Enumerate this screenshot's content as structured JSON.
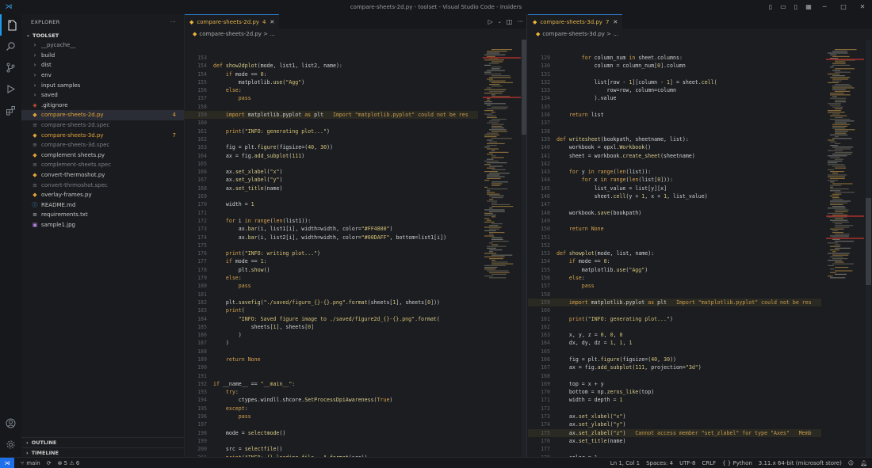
{
  "window": {
    "title": "compare-sheets-2d.py - toolset - Visual Studio Code - Insiders"
  },
  "sidebar": {
    "header": "EXPLORER",
    "root": "TOOLSET",
    "items": [
      {
        "label": "__pycache__",
        "kind": "folder",
        "color": "#9aa0a6"
      },
      {
        "label": "build",
        "kind": "folder",
        "color": "#c5c5c5"
      },
      {
        "label": "dist",
        "kind": "folder",
        "color": "#c5c5c5"
      },
      {
        "label": "env",
        "kind": "folder",
        "color": "#c5c5c5"
      },
      {
        "label": "input samples",
        "kind": "folder",
        "color": "#c5c5c5"
      },
      {
        "label": "saved",
        "kind": "folder",
        "color": "#c5c5c5"
      },
      {
        "label": ".gitignore",
        "kind": "git",
        "color": "#c5c5c5"
      },
      {
        "label": "compare-sheets-2d.py",
        "kind": "py",
        "color": "#e2a23a",
        "badge": "4",
        "selected": true
      },
      {
        "label": "compare-sheets-2d.spec",
        "kind": "spec",
        "color": "#7a7f86"
      },
      {
        "label": "compare-sheets-3d.py",
        "kind": "py",
        "color": "#e2a23a",
        "badge": "7"
      },
      {
        "label": "compare-sheets-3d.spec",
        "kind": "spec",
        "color": "#7a7f86"
      },
      {
        "label": "complement sheets.py",
        "kind": "py",
        "color": "#c5c5c5"
      },
      {
        "label": "complement-sheets.spec",
        "kind": "spec",
        "color": "#7a7f86"
      },
      {
        "label": "convert-thermoshot.py",
        "kind": "py",
        "color": "#c5c5c5"
      },
      {
        "label": "convert-thrmoshot.spec",
        "kind": "spec",
        "color": "#7a7f86"
      },
      {
        "label": "overlay-frames.py",
        "kind": "py",
        "color": "#c5c5c5"
      },
      {
        "label": "README.md",
        "kind": "md",
        "color": "#c5c5c5"
      },
      {
        "label": "requirements.txt",
        "kind": "txt",
        "color": "#c5c5c5"
      },
      {
        "label": "sample1.jpg",
        "kind": "img",
        "color": "#c5c5c5"
      }
    ],
    "outline": "OUTLINE",
    "timeline": "TIMELINE"
  },
  "editor_left": {
    "tab": {
      "label": "compare-sheets-2d.py",
      "badge": "4"
    },
    "breadcrumb": "compare-sheets-2d.py > ...",
    "lines": [
      {
        "n": "153",
        "t": ""
      },
      {
        "n": "154",
        "t": "def show2dplot(mode, list1, list2, name):"
      },
      {
        "n": "154",
        "t": "    if mode == 0:"
      },
      {
        "n": "155",
        "t": "        matplotlib.use(\"Agg\")"
      },
      {
        "n": "156",
        "t": "    else:"
      },
      {
        "n": "157",
        "t": "        pass"
      },
      {
        "n": "158",
        "t": ""
      },
      {
        "n": "159",
        "t": "    import matplotlib.pyplot as plt   Import \"matplotlib.pyplot\" could not be res",
        "hl": true
      },
      {
        "n": "160",
        "t": ""
      },
      {
        "n": "161",
        "t": "    print(\"INFO: generating plot...\")"
      },
      {
        "n": "162",
        "t": ""
      },
      {
        "n": "163",
        "t": "    fig = plt.figure(figsize=(40, 30))"
      },
      {
        "n": "164",
        "t": "    ax = fig.add_subplot(111)"
      },
      {
        "n": "165",
        "t": ""
      },
      {
        "n": "166",
        "t": "    ax.set_xlabel(\"x\")"
      },
      {
        "n": "167",
        "t": "    ax.set_ylabel(\"y\")"
      },
      {
        "n": "168",
        "t": "    ax.set_title(name)"
      },
      {
        "n": "169",
        "t": ""
      },
      {
        "n": "170",
        "t": "    width = 1"
      },
      {
        "n": "171",
        "t": ""
      },
      {
        "n": "172",
        "t": "    for i in range(len(list1)):"
      },
      {
        "n": "173",
        "t": "        ax.bar(i, list1[i], width=width, color=\"#FF4800\")"
      },
      {
        "n": "174",
        "t": "        ax.bar(i, list2[i], width=width, color=\"#00DAFF\", bottom=list1[i])"
      },
      {
        "n": "175",
        "t": ""
      },
      {
        "n": "176",
        "t": "    print(\"INFO: writing plot...\")"
      },
      {
        "n": "177",
        "t": "    if mode == 1:"
      },
      {
        "n": "178",
        "t": "        plt.show()"
      },
      {
        "n": "179",
        "t": "    else:"
      },
      {
        "n": "180",
        "t": "        pass"
      },
      {
        "n": "181",
        "t": ""
      },
      {
        "n": "182",
        "t": "    plt.savefig(\"./saved/figure_{}-{}.png\".format(sheets[1], sheets[0]))"
      },
      {
        "n": "183",
        "t": "    print("
      },
      {
        "n": "184",
        "t": "        \"INFO: Saved figure image to ./saved/figure2d_{}-{}.png\".format("
      },
      {
        "n": "185",
        "t": "            sheets[1], sheets[0]"
      },
      {
        "n": "186",
        "t": "        )"
      },
      {
        "n": "187",
        "t": "    )"
      },
      {
        "n": "188",
        "t": ""
      },
      {
        "n": "189",
        "t": "    return None"
      },
      {
        "n": "190",
        "t": ""
      },
      {
        "n": "191",
        "t": ""
      },
      {
        "n": "192",
        "t": "if __name__ == \"__main__\":"
      },
      {
        "n": "193",
        "t": "    try:"
      },
      {
        "n": "194",
        "t": "        ctypes.windll.shcore.SetProcessDpiAwareness(True)"
      },
      {
        "n": "195",
        "t": "    except:"
      },
      {
        "n": "196",
        "t": "        pass"
      },
      {
        "n": "197",
        "t": ""
      },
      {
        "n": "198",
        "t": "    mode = selectmode()"
      },
      {
        "n": "199",
        "t": ""
      },
      {
        "n": "200",
        "t": "    src = selectfile()"
      },
      {
        "n": "201",
        "t": "    print(\"INFO: {} loading file...\".format(src))"
      }
    ]
  },
  "editor_right": {
    "tab": {
      "label": "compare-sheets-3d.py",
      "badge": "7"
    },
    "breadcrumb": "compare-sheets-3d.py > ...",
    "lines": [
      {
        "n": "129",
        "t": "        for column_num in sheet.columns:"
      },
      {
        "n": "130",
        "t": "            column = column_num[0].column"
      },
      {
        "n": "131",
        "t": ""
      },
      {
        "n": "132",
        "t": "            list[row - 1][column - 1] = sheet.cell("
      },
      {
        "n": "133",
        "t": "                row=row, column=column"
      },
      {
        "n": "134",
        "t": "            ).value"
      },
      {
        "n": "135",
        "t": ""
      },
      {
        "n": "136",
        "t": "    return list"
      },
      {
        "n": "137",
        "t": ""
      },
      {
        "n": "138",
        "t": ""
      },
      {
        "n": "139",
        "t": "def writesheet(bookpath, sheetname, list):"
      },
      {
        "n": "140",
        "t": "    workbook = opxl.Workbook()"
      },
      {
        "n": "141",
        "t": "    sheet = workbook.create_sheet(sheetname)"
      },
      {
        "n": "142",
        "t": ""
      },
      {
        "n": "143",
        "t": "    for y in range(len(list)):"
      },
      {
        "n": "144",
        "t": "        for x in range(len(list[0])):"
      },
      {
        "n": "145",
        "t": "            list_value = list[y][x]"
      },
      {
        "n": "146",
        "t": "            sheet.cell(y + 1, x + 1, list_value)"
      },
      {
        "n": "147",
        "t": ""
      },
      {
        "n": "148",
        "t": "    workbook.save(bookpath)"
      },
      {
        "n": "149",
        "t": ""
      },
      {
        "n": "150",
        "t": "    return None"
      },
      {
        "n": "151",
        "t": ""
      },
      {
        "n": "152",
        "t": ""
      },
      {
        "n": "153",
        "t": "def showplot(mode, list, name):"
      },
      {
        "n": "154",
        "t": "    if mode == 0:"
      },
      {
        "n": "155",
        "t": "        matplotlib.use(\"Agg\")"
      },
      {
        "n": "156",
        "t": "    else:"
      },
      {
        "n": "157",
        "t": "        pass"
      },
      {
        "n": "158",
        "t": ""
      },
      {
        "n": "159",
        "t": "    import matplotlib.pyplot as plt   Import \"matplotlib.pyplot\" could not be res",
        "hl": true
      },
      {
        "n": "160",
        "t": ""
      },
      {
        "n": "161",
        "t": "    print(\"INFO: generating plot...\")"
      },
      {
        "n": "162",
        "t": ""
      },
      {
        "n": "163",
        "t": "    x, y, z = 0, 0, 0"
      },
      {
        "n": "164",
        "t": "    dx, dy, dz = 1, 1, 1"
      },
      {
        "n": "165",
        "t": ""
      },
      {
        "n": "166",
        "t": "    fig = plt.figure(figsize=(40, 30))"
      },
      {
        "n": "167",
        "t": "    ax = fig.add_subplot(111, projection=\"3d\")"
      },
      {
        "n": "168",
        "t": ""
      },
      {
        "n": "169",
        "t": "    top = x + y"
      },
      {
        "n": "170",
        "t": "    bottom = np.zeros_like(top)"
      },
      {
        "n": "171",
        "t": "    width = depth = 1"
      },
      {
        "n": "172",
        "t": ""
      },
      {
        "n": "173",
        "t": "    ax.set_xlabel(\"x\")"
      },
      {
        "n": "174",
        "t": "    ax.set_ylabel(\"y\")"
      },
      {
        "n": "175",
        "t": "    ax.set_zlabel(\"z\")   Cannot access member \"set_zlabel\" for type \"Axes\"   Memb",
        "hl": true
      },
      {
        "n": "176",
        "t": "    ax.set_title(name)"
      },
      {
        "n": "177",
        "t": ""
      },
      {
        "n": "178",
        "t": "    color = 1"
      }
    ]
  },
  "status": {
    "branch": "main",
    "problems": "⊗ 5 ⚠ 6",
    "position": "Ln 1, Col 1",
    "spaces": "Spaces: 4",
    "encoding": "UTF-8",
    "eol": "CRLF",
    "language": "{ } Python",
    "interpreter": "3.11.x 64-bit (microsoft store)"
  },
  "colors": {
    "accent": "#1f6feb",
    "warning": "#e2a23a",
    "keyword": "#d7a24e"
  }
}
